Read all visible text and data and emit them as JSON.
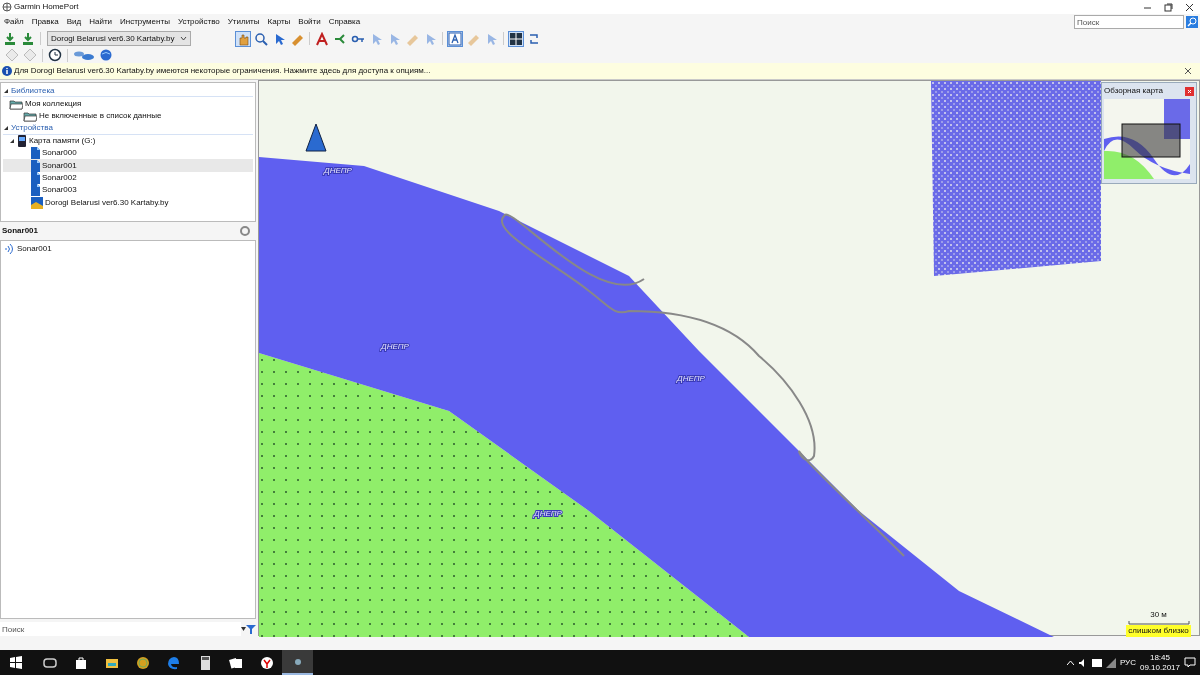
{
  "window": {
    "title": "Garmin HomePort"
  },
  "menu": [
    "Файл",
    "Правка",
    "Вид",
    "Найти",
    "Инструменты",
    "Устройство",
    "Утилиты",
    "Карты",
    "Войти",
    "Справка"
  ],
  "toolbar": {
    "map_select": "Dorogi Belarusi ver6.30 Kartaby.by",
    "search_placeholder": "Поиск",
    "tool_rows": [
      {
        "tools": [
          {
            "kind": "send",
            "selected": false,
            "disabled": false
          },
          {
            "kind": "send",
            "selected": false,
            "disabled": false
          },
          {
            "kind": "select"
          },
          {
            "kind": "pan",
            "selected": true,
            "disabled": false
          },
          {
            "kind": "zoom",
            "selected": false,
            "disabled": false
          },
          {
            "kind": "pointer",
            "selected": false,
            "disabled": false
          },
          {
            "kind": "ruler",
            "selected": false,
            "disabled": false
          },
          {
            "kind": "route",
            "selected": false,
            "disabled": false
          },
          {
            "kind": "branch",
            "selected": false,
            "disabled": false
          },
          {
            "kind": "key",
            "selected": false,
            "disabled": false
          },
          {
            "kind": "pointer",
            "selected": false,
            "disabled": true
          },
          {
            "kind": "pointer",
            "selected": false,
            "disabled": true
          },
          {
            "kind": "ruler",
            "selected": false,
            "disabled": true
          },
          {
            "kind": "pointer",
            "selected": false,
            "disabled": true
          },
          {
            "kind": "text",
            "selected": true,
            "disabled": false
          },
          {
            "kind": "ruler",
            "selected": false,
            "disabled": true
          },
          {
            "kind": "pointer",
            "selected": false,
            "disabled": true
          },
          {
            "kind": "grid",
            "selected": true,
            "disabled": false
          },
          {
            "kind": "swap",
            "selected": false,
            "disabled": false
          }
        ]
      },
      {
        "tools": [
          {
            "kind": "diamond",
            "selected": false,
            "disabled": true
          },
          {
            "kind": "diamond",
            "selected": false,
            "disabled": true
          },
          {
            "kind": "clock",
            "selected": false,
            "disabled": false
          },
          {
            "kind": "clouds",
            "selected": false,
            "disabled": false
          },
          {
            "kind": "globe",
            "selected": false,
            "disabled": false
          }
        ]
      }
    ]
  },
  "info_bar": {
    "text": "Для Dorogi Belarusi ver6.30 Kartaby.by имеются некоторые ограничения. Нажмите здесь для доступа к опциям..."
  },
  "library": {
    "label": "Библиотека",
    "expanded": true,
    "items": [
      {
        "label": "Моя коллекция",
        "children": [
          {
            "label": "Не включенные в список данные"
          }
        ]
      }
    ]
  },
  "devices": {
    "label": "Устройства",
    "expanded": true,
    "items": [
      {
        "label": "Карта памяти (G:)",
        "expanded": true,
        "children": [
          {
            "label": "Sonar000",
            "kind": "sonar",
            "selected": false
          },
          {
            "label": "Sonar001",
            "kind": "sonar",
            "selected": true
          },
          {
            "label": "Sonar002",
            "kind": "sonar",
            "selected": false
          },
          {
            "label": "Sonar003",
            "kind": "sonar",
            "selected": false
          },
          {
            "label": "Dorogi Belarusi ver6.30 Kartaby.by",
            "kind": "map",
            "selected": false
          }
        ]
      }
    ]
  },
  "details": {
    "title": "Sonar001",
    "items": [
      "Sonar001"
    ]
  },
  "filter": {
    "placeholder": "Поиск"
  },
  "map": {
    "labels": [
      "ДНЕПР",
      "ДНЕПР",
      "ДНЕПР",
      "ДНЕПР"
    ],
    "overview": {
      "title": "Обзорная карта"
    },
    "scale": "30 м",
    "warning": "слишком близко"
  },
  "taskbar": {
    "apps": [
      {
        "kind": "start",
        "selected": false
      },
      {
        "kind": "taskview",
        "selected": false
      },
      {
        "kind": "store",
        "selected": false
      },
      {
        "kind": "explorer",
        "selected": false
      },
      {
        "kind": "smiley",
        "selected": false
      },
      {
        "kind": "edge",
        "selected": false
      },
      {
        "kind": "calculator",
        "selected": false
      },
      {
        "kind": "cards",
        "selected": false
      },
      {
        "kind": "yandex",
        "selected": false
      },
      {
        "kind": "homeport",
        "selected": true
      }
    ],
    "language": "РУС",
    "time": "18:45",
    "date": "09.10.2017"
  }
}
